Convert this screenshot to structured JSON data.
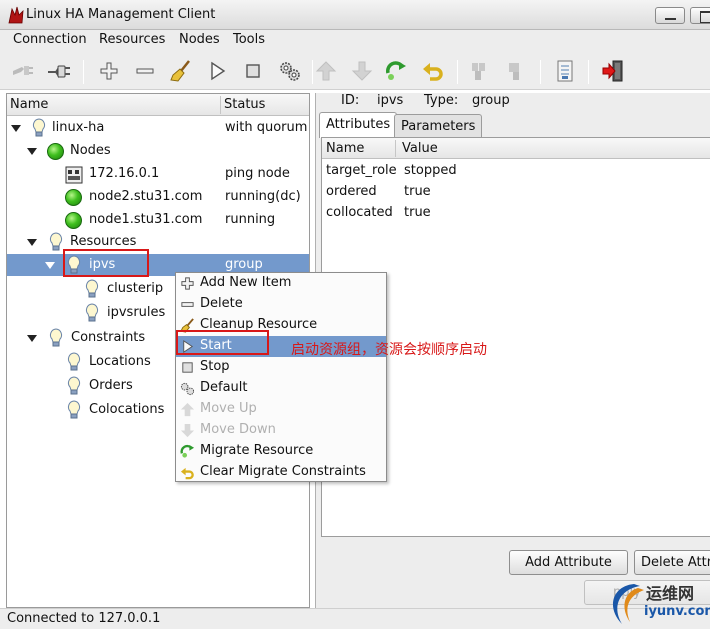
{
  "window": {
    "title": "Linux HA Management Client"
  },
  "menubar": [
    "Connection",
    "Resources",
    "Nodes",
    "Tools"
  ],
  "tree": {
    "headers": {
      "name": "Name",
      "status": "Status"
    },
    "rows": [
      {
        "label": "linux-ha",
        "status": "with quorum"
      },
      {
        "label": "Nodes",
        "status": ""
      },
      {
        "label": "172.16.0.1",
        "status": "ping node"
      },
      {
        "label": "node2.stu31.com",
        "status": "running(dc)"
      },
      {
        "label": "node1.stu31.com",
        "status": "running"
      },
      {
        "label": "Resources",
        "status": ""
      },
      {
        "label": "ipvs",
        "status": "group"
      },
      {
        "label": "clusterip",
        "status": ""
      },
      {
        "label": "ipvsrules",
        "status": ""
      },
      {
        "label": "Constraints",
        "status": ""
      },
      {
        "label": "Locations",
        "status": ""
      },
      {
        "label": "Orders",
        "status": ""
      },
      {
        "label": "Colocations",
        "status": ""
      }
    ]
  },
  "detail": {
    "id_label": "ID:",
    "id_value": "ipvs",
    "type_label": "Type:",
    "type_value": "group",
    "tabs": [
      "Attributes",
      "Parameters"
    ],
    "columns": [
      "Name",
      "Value"
    ],
    "attributes": [
      {
        "name": "target_role",
        "value": "stopped"
      },
      {
        "name": "ordered",
        "value": "true"
      },
      {
        "name": "collocated",
        "value": "true"
      }
    ],
    "add_button": "Add Attribute",
    "delete_button": "Delete Attri",
    "apply_button": "pply"
  },
  "context_menu": [
    {
      "label": "Add New Item",
      "icon": "plus-icon",
      "enabled": true
    },
    {
      "label": "Delete",
      "icon": "minus-icon",
      "enabled": true
    },
    {
      "label": "Cleanup Resource",
      "icon": "broom-icon",
      "enabled": true
    },
    {
      "label": "Start",
      "icon": "play-icon",
      "enabled": true,
      "highlighted": true
    },
    {
      "label": "Stop",
      "icon": "stop-icon",
      "enabled": true
    },
    {
      "label": "Default",
      "icon": "gears-icon",
      "enabled": true
    },
    {
      "label": "Move Up",
      "icon": "arrow-up-icon",
      "enabled": false
    },
    {
      "label": "Move Down",
      "icon": "arrow-down-icon",
      "enabled": false
    },
    {
      "label": "Migrate Resource",
      "icon": "migrate-icon",
      "enabled": true
    },
    {
      "label": "Clear Migrate Constraints",
      "icon": "undo-icon",
      "enabled": true
    }
  ],
  "annotation": "启动资源组，资源会按顺序启动",
  "status_bar": "Connected to 127.0.0.1",
  "watermark": {
    "cn": "运维网",
    "en": "iyunv.com"
  },
  "colors": {
    "selection": "#7399cc",
    "annotation": "#d81818"
  }
}
